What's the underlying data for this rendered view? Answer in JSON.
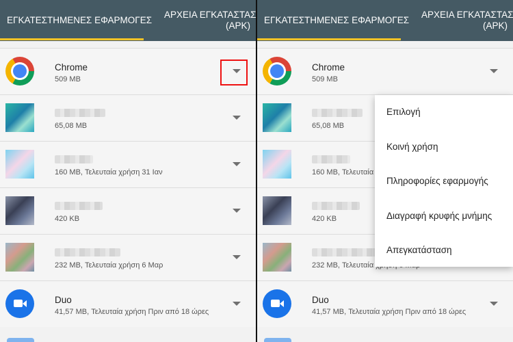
{
  "tabs": {
    "installed": "ΕΓΚΑΤΕΣΤΗΜΕΝΕΣ ΕΦΑΡΜΟΓΕΣ",
    "apk_line1": "ΑΡΧΕΙΑ ΕΓΚΑΤΑΣΤΑΣΗΣ",
    "apk_line2": "(APK)"
  },
  "apps": [
    {
      "name": "Chrome",
      "sub": "509 MB",
      "icon": "chrome-icon"
    },
    {
      "name": "",
      "sub": "65,08 MB",
      "icon": "blurred-app-icon"
    },
    {
      "name": "",
      "sub": "160 MB, Τελευταία χρήση 31 Ιαν",
      "icon": "blurred-app-icon"
    },
    {
      "name": "",
      "sub": "420 KB",
      "icon": "blurred-app-icon"
    },
    {
      "name": "",
      "sub": "232 MB, Τελευταία χρήση 6 Μαρ",
      "icon": "blurred-app-icon"
    },
    {
      "name": "Duo",
      "sub": "41,57 MB, Τελευταία χρήση Πριν από 18 ώρες",
      "icon": "duo-icon"
    }
  ],
  "menu": {
    "items": [
      "Επιλογή",
      "Κοινή χρήση",
      "Πληροφορίες εφαρμογής",
      "Διαγραφή κρυφής μνήμης",
      "Απεγκατάσταση"
    ]
  },
  "colors": {
    "tabbar": "#455a64",
    "indicator": "#f5c326",
    "highlight": "#e11111"
  }
}
